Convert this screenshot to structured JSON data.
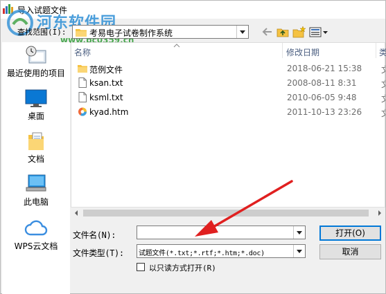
{
  "window": {
    "title": "导入试题文件"
  },
  "watermark": {
    "text": "河东软件园",
    "url": "www.pc0359.cn"
  },
  "lookin": {
    "label": "查找范围(I):",
    "value": "考易电子试卷制作系统"
  },
  "places": {
    "recent": "最近使用的项目",
    "desktop": "桌面",
    "documents": "文档",
    "this_pc": "此电脑",
    "wps_cloud": "WPS云文档"
  },
  "columns": {
    "name": "名称",
    "modified": "修改日期",
    "type": "类"
  },
  "files": [
    {
      "name": "范例文件",
      "date": "2018-06-21 15:38",
      "type": "文",
      "icon": "folder-icon"
    },
    {
      "name": "ksan.txt",
      "date": "2008-08-11 8:31",
      "type": "文",
      "icon": "text-file-icon"
    },
    {
      "name": "ksml.txt",
      "date": "2010-06-05 9:48",
      "type": "文",
      "icon": "text-file-icon"
    },
    {
      "name": "kyad.htm",
      "date": "2011-10-13 23:26",
      "type": "文",
      "icon": "html-file-icon"
    }
  ],
  "form": {
    "filename_label": "文件名(N):",
    "filename_value": "",
    "filetype_label": "文件类型(T):",
    "filetype_value": "试题文件(*.txt;*.rtf;*.htm;*.doc)",
    "readonly_label": "以只读方式打开(R)"
  },
  "buttons": {
    "open": "打开(O)",
    "cancel": "取消"
  },
  "colors": {
    "accent": "#0078d7",
    "annotation_arrow": "#e02020",
    "folder": "#f5c242"
  }
}
